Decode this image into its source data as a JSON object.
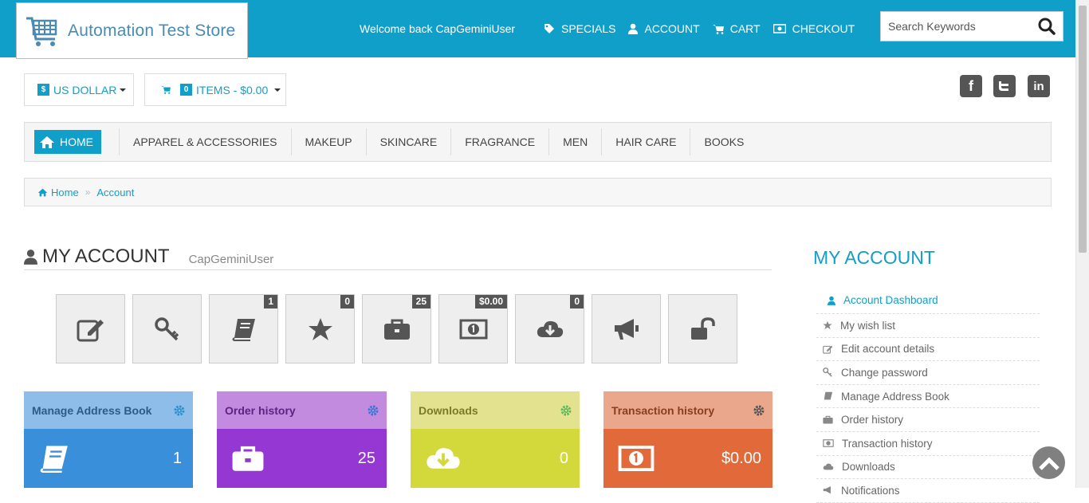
{
  "header": {
    "logo_text": "Automation Test Store",
    "welcome": "Welcome back CapGeminiUser",
    "nav": [
      {
        "label": "SPECIALS",
        "icon": "tag-icon"
      },
      {
        "label": "ACCOUNT",
        "icon": "user-icon"
      },
      {
        "label": "CART",
        "icon": "cart-icon"
      },
      {
        "label": "CHECKOUT",
        "icon": "money-icon"
      }
    ],
    "search_placeholder": "Search Keywords"
  },
  "currency": {
    "symbol": "$",
    "label": "US DOLLAR"
  },
  "minicart": {
    "count": "0",
    "label": "ITEMS - $0.00"
  },
  "social": [
    "facebook-icon",
    "twitter-icon",
    "linkedin-icon"
  ],
  "mainnav": {
    "home": "HOME",
    "items": [
      "APPAREL & ACCESSORIES",
      "MAKEUP",
      "SKINCARE",
      "FRAGRANCE",
      "MEN",
      "HAIR CARE",
      "BOOKS"
    ]
  },
  "breadcrumb": {
    "home": "Home",
    "current": "Account"
  },
  "account": {
    "title": "MY ACCOUNT",
    "username": "CapGeminiUser",
    "tiles": [
      {
        "name": "edit-account-tile",
        "icon": "edit-icon",
        "count": ""
      },
      {
        "name": "change-password-tile",
        "icon": "key-icon",
        "count": ""
      },
      {
        "name": "address-book-tile",
        "icon": "book-icon",
        "count": "1"
      },
      {
        "name": "wishlist-tile",
        "icon": "star-icon",
        "count": "0"
      },
      {
        "name": "order-history-tile",
        "icon": "briefcase-icon",
        "count": "25"
      },
      {
        "name": "transactions-tile",
        "icon": "money-icon",
        "count": "$0.00"
      },
      {
        "name": "downloads-tile",
        "icon": "cloud-download-icon",
        "count": "0"
      },
      {
        "name": "notifications-tile",
        "icon": "bullhorn-icon",
        "count": ""
      },
      {
        "name": "logout-tile",
        "icon": "unlock-icon",
        "count": ""
      }
    ],
    "cards": [
      {
        "title": "Manage Address Book",
        "value": "1",
        "icon": "book-icon",
        "head_color": "#8dbde8",
        "body_color": "#3a8fdb",
        "title_color": "#2c5c86"
      },
      {
        "title": "Order history",
        "value": "25",
        "icon": "briefcase-icon",
        "head_color": "#c28be0",
        "body_color": "#9437d3",
        "title_color": "#5b2483"
      },
      {
        "title": "Downloads",
        "value": "0",
        "icon": "cloud-download-icon",
        "head_color": "#e3e38f",
        "body_color": "#d3d93a",
        "title_color": "#7a7a2a"
      },
      {
        "title": "Transaction history",
        "value": "$0.00",
        "icon": "money-icon",
        "head_color": "#eaa78b",
        "body_color": "#e2693a",
        "title_color": "#8a3e1f"
      }
    ]
  },
  "sidebar": {
    "title": "MY ACCOUNT",
    "items": [
      {
        "label": "Account Dashboard",
        "icon": "user-icon"
      },
      {
        "label": "My wish list",
        "icon": "star-icon"
      },
      {
        "label": "Edit account details",
        "icon": "edit-icon"
      },
      {
        "label": "Change password",
        "icon": "key-icon"
      },
      {
        "label": "Manage Address Book",
        "icon": "book-icon"
      },
      {
        "label": "Order history",
        "icon": "briefcase-icon"
      },
      {
        "label": "Transaction history",
        "icon": "money-icon"
      },
      {
        "label": "Downloads",
        "icon": "cloud-download-icon"
      },
      {
        "label": "Notifications",
        "icon": "bullhorn-icon"
      }
    ]
  },
  "colors": {
    "accent": "#0f9fc8"
  }
}
